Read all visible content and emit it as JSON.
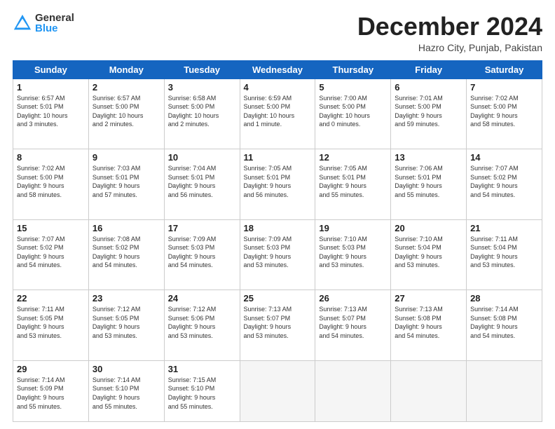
{
  "header": {
    "logo_general": "General",
    "logo_blue": "Blue",
    "month_title": "December 2024",
    "location": "Hazro City, Punjab, Pakistan"
  },
  "days_of_week": [
    "Sunday",
    "Monday",
    "Tuesday",
    "Wednesday",
    "Thursday",
    "Friday",
    "Saturday"
  ],
  "weeks": [
    [
      {
        "day": 1,
        "info": "Sunrise: 6:57 AM\nSunset: 5:01 PM\nDaylight: 10 hours\nand 3 minutes."
      },
      {
        "day": 2,
        "info": "Sunrise: 6:57 AM\nSunset: 5:00 PM\nDaylight: 10 hours\nand 2 minutes."
      },
      {
        "day": 3,
        "info": "Sunrise: 6:58 AM\nSunset: 5:00 PM\nDaylight: 10 hours\nand 2 minutes."
      },
      {
        "day": 4,
        "info": "Sunrise: 6:59 AM\nSunset: 5:00 PM\nDaylight: 10 hours\nand 1 minute."
      },
      {
        "day": 5,
        "info": "Sunrise: 7:00 AM\nSunset: 5:00 PM\nDaylight: 10 hours\nand 0 minutes."
      },
      {
        "day": 6,
        "info": "Sunrise: 7:01 AM\nSunset: 5:00 PM\nDaylight: 9 hours\nand 59 minutes."
      },
      {
        "day": 7,
        "info": "Sunrise: 7:02 AM\nSunset: 5:00 PM\nDaylight: 9 hours\nand 58 minutes."
      }
    ],
    [
      {
        "day": 8,
        "info": "Sunrise: 7:02 AM\nSunset: 5:00 PM\nDaylight: 9 hours\nand 58 minutes."
      },
      {
        "day": 9,
        "info": "Sunrise: 7:03 AM\nSunset: 5:01 PM\nDaylight: 9 hours\nand 57 minutes."
      },
      {
        "day": 10,
        "info": "Sunrise: 7:04 AM\nSunset: 5:01 PM\nDaylight: 9 hours\nand 56 minutes."
      },
      {
        "day": 11,
        "info": "Sunrise: 7:05 AM\nSunset: 5:01 PM\nDaylight: 9 hours\nand 56 minutes."
      },
      {
        "day": 12,
        "info": "Sunrise: 7:05 AM\nSunset: 5:01 PM\nDaylight: 9 hours\nand 55 minutes."
      },
      {
        "day": 13,
        "info": "Sunrise: 7:06 AM\nSunset: 5:01 PM\nDaylight: 9 hours\nand 55 minutes."
      },
      {
        "day": 14,
        "info": "Sunrise: 7:07 AM\nSunset: 5:02 PM\nDaylight: 9 hours\nand 54 minutes."
      }
    ],
    [
      {
        "day": 15,
        "info": "Sunrise: 7:07 AM\nSunset: 5:02 PM\nDaylight: 9 hours\nand 54 minutes."
      },
      {
        "day": 16,
        "info": "Sunrise: 7:08 AM\nSunset: 5:02 PM\nDaylight: 9 hours\nand 54 minutes."
      },
      {
        "day": 17,
        "info": "Sunrise: 7:09 AM\nSunset: 5:03 PM\nDaylight: 9 hours\nand 54 minutes."
      },
      {
        "day": 18,
        "info": "Sunrise: 7:09 AM\nSunset: 5:03 PM\nDaylight: 9 hours\nand 53 minutes."
      },
      {
        "day": 19,
        "info": "Sunrise: 7:10 AM\nSunset: 5:03 PM\nDaylight: 9 hours\nand 53 minutes."
      },
      {
        "day": 20,
        "info": "Sunrise: 7:10 AM\nSunset: 5:04 PM\nDaylight: 9 hours\nand 53 minutes."
      },
      {
        "day": 21,
        "info": "Sunrise: 7:11 AM\nSunset: 5:04 PM\nDaylight: 9 hours\nand 53 minutes."
      }
    ],
    [
      {
        "day": 22,
        "info": "Sunrise: 7:11 AM\nSunset: 5:05 PM\nDaylight: 9 hours\nand 53 minutes."
      },
      {
        "day": 23,
        "info": "Sunrise: 7:12 AM\nSunset: 5:05 PM\nDaylight: 9 hours\nand 53 minutes."
      },
      {
        "day": 24,
        "info": "Sunrise: 7:12 AM\nSunset: 5:06 PM\nDaylight: 9 hours\nand 53 minutes."
      },
      {
        "day": 25,
        "info": "Sunrise: 7:13 AM\nSunset: 5:07 PM\nDaylight: 9 hours\nand 53 minutes."
      },
      {
        "day": 26,
        "info": "Sunrise: 7:13 AM\nSunset: 5:07 PM\nDaylight: 9 hours\nand 54 minutes."
      },
      {
        "day": 27,
        "info": "Sunrise: 7:13 AM\nSunset: 5:08 PM\nDaylight: 9 hours\nand 54 minutes."
      },
      {
        "day": 28,
        "info": "Sunrise: 7:14 AM\nSunset: 5:08 PM\nDaylight: 9 hours\nand 54 minutes."
      }
    ],
    [
      {
        "day": 29,
        "info": "Sunrise: 7:14 AM\nSunset: 5:09 PM\nDaylight: 9 hours\nand 55 minutes."
      },
      {
        "day": 30,
        "info": "Sunrise: 7:14 AM\nSunset: 5:10 PM\nDaylight: 9 hours\nand 55 minutes."
      },
      {
        "day": 31,
        "info": "Sunrise: 7:15 AM\nSunset: 5:10 PM\nDaylight: 9 hours\nand 55 minutes."
      },
      null,
      null,
      null,
      null
    ]
  ]
}
